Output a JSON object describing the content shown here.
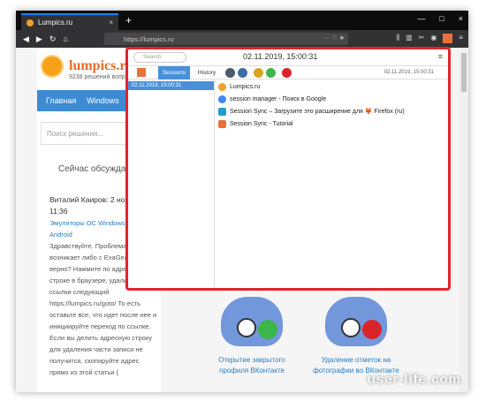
{
  "browser": {
    "tab_title": "Lumpics.ru",
    "tab_close": "×",
    "new_tab": "+",
    "url": "https://lumpics.ru",
    "window_controls": [
      "—",
      "□",
      "×"
    ]
  },
  "site": {
    "name": "lumpics.ru",
    "slogan": "9238 решений вопрос",
    "menu": [
      "Главная",
      "Windows",
      "Др"
    ],
    "search_placeholder": "Поиск решения...",
    "discussion_title": "Сейчас обсуждаем",
    "comment_author": "Виталий Каиров: 2 ноября 11:36",
    "comment_link": "Эмуляторы ОС Windows для Android",
    "comment_text": "Здравствуйте. Проблема возникает либо с ExaGear QEMU, верно? Нажмите по адресной строке в браузере, удалите из ссылки следующий https://lumpics.ru/goto/ То есть оставьте все, что идет после нее и инициируйте переход по ссылке. Если вы делить адресную строку для удаления части записи не получится, скопируйте адрес прямо из этой статьи (",
    "promo1": "Открытие закрытого профиля ВКонтакте",
    "promo2": "Удаление отметок на фотографии во ВКонтакте",
    "watermark": "user-life.com"
  },
  "popup": {
    "search_placeholder": "Search",
    "date": "02.11.2019, 15:00:31",
    "date_small": "02.11.2019, 15:00:31",
    "tab_sessions": "Sessions",
    "tab_history": "History",
    "session_item": "02.11.2019, 15:00:31",
    "entries": [
      {
        "title": "Lumpics.ru",
        "color": "#f0a030"
      },
      {
        "title": "session manager - Поиск в Google",
        "color": "#4285f4"
      },
      {
        "title": "Session Sync – Загрузите это расширение для 🦊 Firefox (ru)",
        "color": "#1fa0c8"
      },
      {
        "title": "Session Sync - Tutorial",
        "color": "#e8723a"
      }
    ]
  },
  "colors": {
    "accent_red": "#e0242c",
    "accent_blue": "#4a90d9",
    "site_blue": "#3d8bd3"
  }
}
